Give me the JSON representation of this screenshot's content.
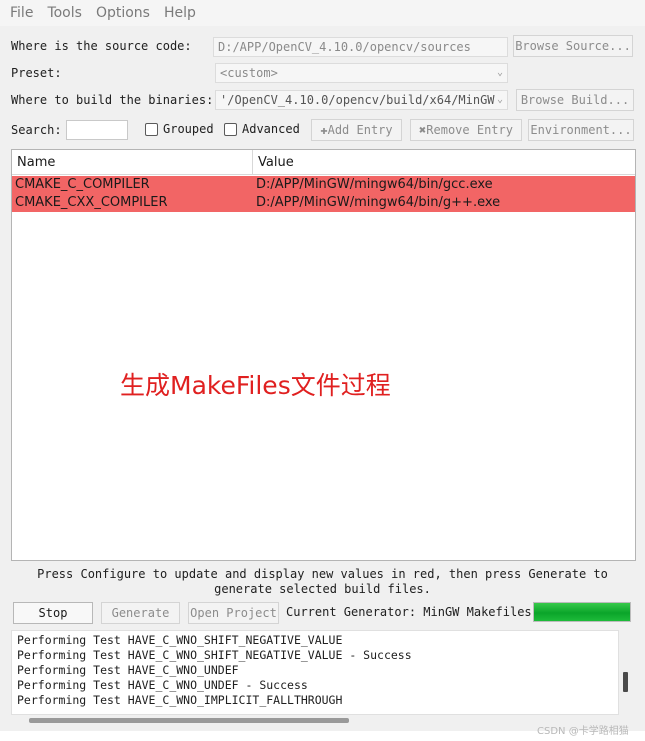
{
  "menu": [
    "File",
    "Tools",
    "Options",
    "Help"
  ],
  "source": {
    "label": "Where is the source code:",
    "value": "D:/APP/OpenCV_4.10.0/opencv/sources",
    "button": "Browse Source..."
  },
  "preset": {
    "label": "Preset:",
    "value": "<custom>"
  },
  "build": {
    "label": "Where to build the binaries:",
    "value": "'/OpenCV_4.10.0/opencv/build/x64/MinGW",
    "button": "Browse Build..."
  },
  "toolbar": {
    "search_label": "Search:",
    "search_value": "",
    "grouped": "Grouped",
    "advanced": "Advanced",
    "add_entry": "Add Entry",
    "remove_entry": "Remove Entry",
    "environment": "Environment..."
  },
  "table": {
    "headers": [
      "Name",
      "Value"
    ],
    "rows": [
      {
        "name": "CMAKE_C_COMPILER",
        "value": "D:/APP/MinGW/mingw64/bin/gcc.exe"
      },
      {
        "name": "CMAKE_CXX_COMPILER",
        "value": "D:/APP/MinGW/mingw64/bin/g++.exe"
      }
    ],
    "highlight_color": "#f26565"
  },
  "overlay_text": "生成MakeFiles文件过程",
  "hint": {
    "line1": "Press Configure to update and display new values in red, then press Generate to",
    "line2": "generate selected build files."
  },
  "actions": {
    "stop": "Stop",
    "generate": "Generate",
    "open_project": "Open Project",
    "generator_label": "Current Generator: MinGW Makefiles",
    "progress": 1.0
  },
  "log": [
    "Performing Test HAVE_C_WNO_SHIFT_NEGATIVE_VALUE",
    "Performing Test HAVE_C_WNO_SHIFT_NEGATIVE_VALUE - Success",
    "Performing Test HAVE_C_WNO_UNDEF",
    "Performing Test HAVE_C_WNO_UNDEF - Success",
    "Performing Test HAVE_C_WNO_IMPLICIT_FALLTHROUGH"
  ],
  "watermark": "CSDN @卡学路相猫",
  "colors": {
    "accent_progress": "#1dbb3a",
    "overlay_text": "#e02020"
  }
}
